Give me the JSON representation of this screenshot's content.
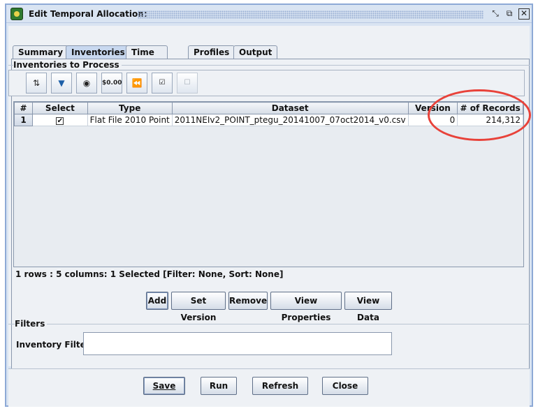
{
  "window": {
    "title": "Edit Temporal Allocation:",
    "controls": [
      "restore-icon",
      "maximize-icon",
      "close-icon"
    ]
  },
  "tabs": [
    "Summary",
    "Inventories",
    "Time Period",
    "Profiles",
    "Output"
  ],
  "active_tab": "Inventories",
  "inventories": {
    "group_title": "Inventories to Process",
    "toolbar_icons": [
      "sort-icon",
      "filter-icon",
      "view-icon",
      "format-icon",
      "reset-icon",
      "select-all-icon",
      "clear-selection-icon"
    ],
    "toolbar_format_label": "$0.00",
    "columns": [
      "#",
      "Select",
      "Type",
      "Dataset",
      "Version",
      "# of Records"
    ],
    "rows": [
      {
        "num": "1",
        "select": "✔",
        "type": "Flat File 2010 Point",
        "dataset": "2011NEIv2_POINT_ptegu_20141007_07oct2014_v0.csv",
        "version": "0",
        "records": "214,312"
      }
    ],
    "status": "1 rows : 5 columns: 1 Selected [Filter: None, Sort: None]",
    "buttons": {
      "add": "Add",
      "set_version": "Set Version",
      "remove": "Remove",
      "view_properties": "View Properties",
      "view_data": "View Data"
    }
  },
  "filters": {
    "group_title": "Filters",
    "inventory_filter_label": "Inventory Filter:",
    "inventory_filter_value": ""
  },
  "footer": {
    "save": "Save",
    "run": "Run",
    "refresh": "Refresh",
    "close": "Close"
  },
  "colors": {
    "annotation": "#e8423a",
    "accent": "#8da9d6"
  }
}
